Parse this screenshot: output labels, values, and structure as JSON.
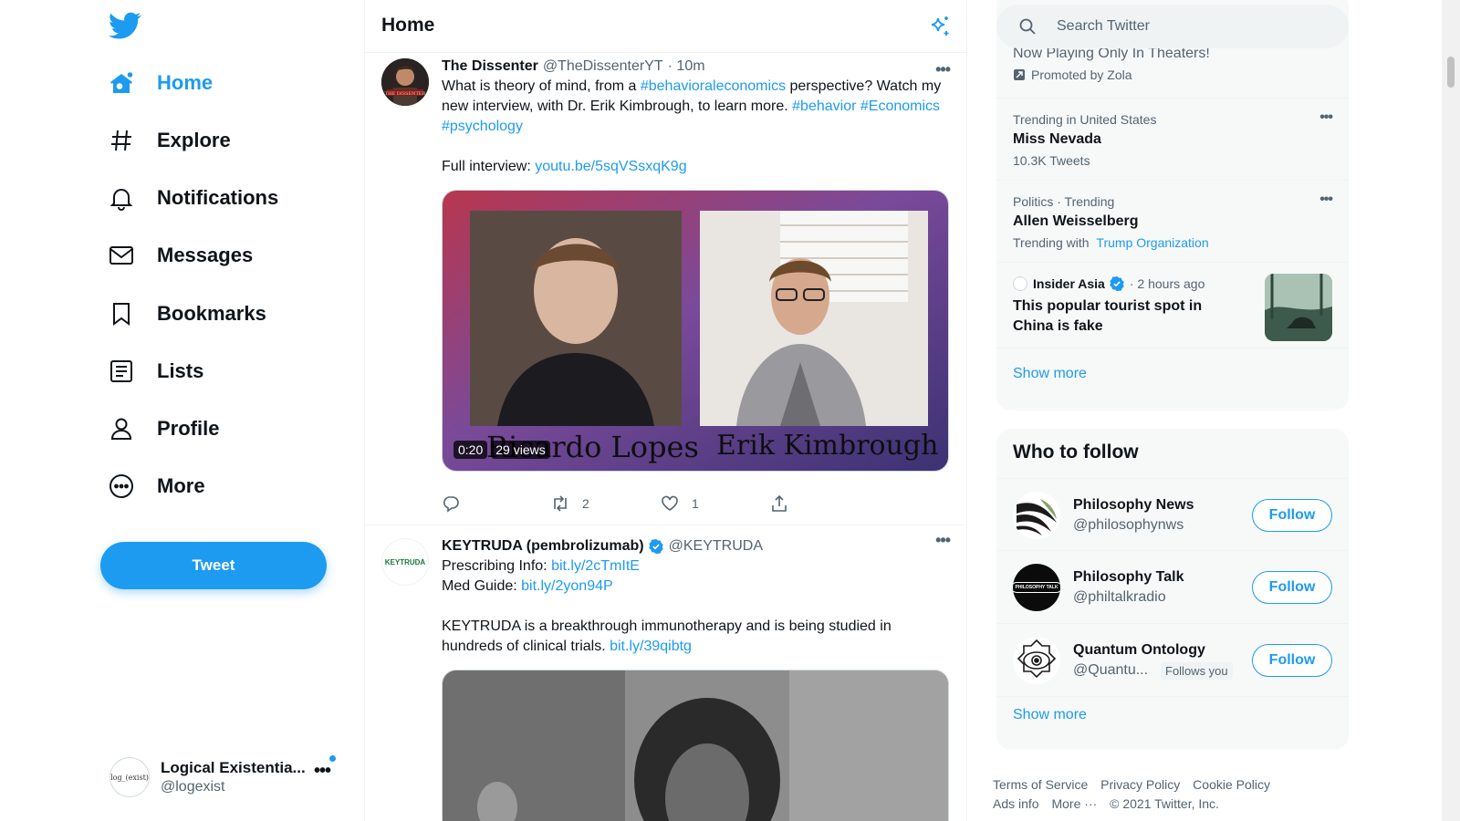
{
  "sidebar": {
    "nav": [
      {
        "label": "Home",
        "icon": "home-icon"
      },
      {
        "label": "Explore",
        "icon": "hashtag-icon"
      },
      {
        "label": "Notifications",
        "icon": "bell-icon"
      },
      {
        "label": "Messages",
        "icon": "envelope-icon"
      },
      {
        "label": "Bookmarks",
        "icon": "bookmark-icon"
      },
      {
        "label": "Lists",
        "icon": "list-icon"
      },
      {
        "label": "Profile",
        "icon": "person-icon"
      },
      {
        "label": "More",
        "icon": "more-circle-icon"
      }
    ],
    "tweet_button": "Tweet",
    "account": {
      "avatar_text": "log_(exist)",
      "display_name": "Logical Existentia...",
      "handle": "@logexist"
    }
  },
  "main": {
    "title": "Home",
    "tweets": [
      {
        "name": "The Dissenter",
        "handle": "@TheDissenterYT",
        "time": "· 10m",
        "text_parts": [
          {
            "t": "What is theory of mind, from a ",
            "link": false
          },
          {
            "t": "#behavioraleconomics",
            "link": true
          },
          {
            "t": " perspective? Watch my new interview, with Dr. Erik Kimbrough, to learn more. ",
            "link": false
          },
          {
            "t": "#behavior",
            "link": true
          },
          {
            "t": " ",
            "link": false
          },
          {
            "t": "#Economics",
            "link": true
          },
          {
            "t": " ",
            "link": false
          },
          {
            "t": "#psychology",
            "link": true
          }
        ],
        "full_interview_label": "Full interview: ",
        "full_interview_link": "youtu.be/5sqVSsxqK9g",
        "video": {
          "duration": "0:20",
          "views": "29 views",
          "caption_left": "Ricardo Lopes",
          "caption_right": "Erik Kimbrough"
        },
        "retweets": "2",
        "likes": "1"
      },
      {
        "name": "KEYTRUDA (pembrolizumab)",
        "handle": "@KEYTRUDA",
        "avatar_text": "KEYTRUDA",
        "line1_label": "Prescribing Info: ",
        "line1_link": "bit.ly/2cTmItE",
        "line2_label": "Med Guide: ",
        "line2_link": "bit.ly/2yon94P",
        "text": "KEYTRUDA is a breakthrough immunotherapy and is being studied in hundreds of clinical trials. ",
        "text_link": "bit.ly/39qibtg"
      }
    ]
  },
  "right": {
    "search_placeholder": "Search Twitter",
    "trends": {
      "promoted_title": "Now Playing Only In Theaters!",
      "promoted_by": "Promoted by Zola",
      "items": [
        {
          "context": "Trending in United States",
          "title": "Miss Nevada",
          "meta": "10.3K Tweets"
        },
        {
          "context": "Politics · Trending",
          "title": "Allen Weisselberg",
          "meta_prefix": "Trending with",
          "meta_link": "Trump Organization"
        }
      ],
      "news": {
        "source": "Insider Asia",
        "time": "· 2 hours ago",
        "headline": "This popular tourist spot in China is fake"
      },
      "show_more": "Show more"
    },
    "who_to_follow": {
      "title": "Who to follow",
      "accounts": [
        {
          "name": "Philosophy News",
          "handle": "@philosophynws",
          "button": "Follow"
        },
        {
          "name": "Philosophy Talk",
          "handle": "@philtalkradio",
          "button": "Follow",
          "avatar_text": "PHILOSOPHY TALK"
        },
        {
          "name": "Quantum Ontology",
          "handle": "@Quantu...",
          "follows_you": "Follows you",
          "button": "Follow"
        }
      ],
      "show_more": "Show more"
    },
    "footer": {
      "links": [
        "Terms of Service",
        "Privacy Policy",
        "Cookie Policy",
        "Ads info",
        "More ···"
      ],
      "copyright": "© 2021 Twitter, Inc."
    }
  },
  "colors": {
    "accent": "#1d9bf0",
    "text": "#0f1419",
    "muted": "#536471",
    "panel": "#f7f9f9"
  }
}
